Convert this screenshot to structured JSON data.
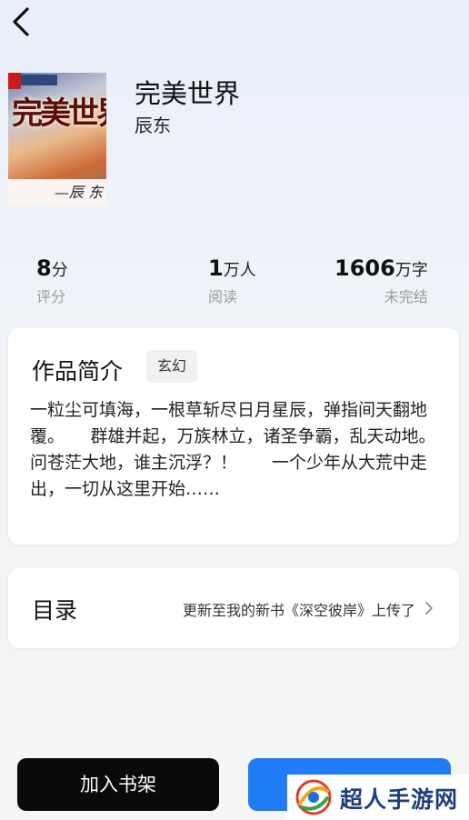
{
  "book": {
    "title": "完美世界",
    "author": "辰东",
    "cover_title": "完美世界",
    "cover_author": "—辰 东"
  },
  "stats": {
    "rating": {
      "value": "8",
      "unit": "分",
      "label": "评分"
    },
    "readers": {
      "value": "1",
      "unit": "万人",
      "label": "阅读"
    },
    "words": {
      "value": "1606",
      "unit": "万字",
      "label": "未完结"
    }
  },
  "intro": {
    "heading": "作品简介",
    "genre": "玄幻",
    "text": "一粒尘可填海，一根草斩尽日月星辰，弹指间天翻地覆。　　群雄并起，万族林立，诸圣争霸，乱天动地。问苍茫大地，谁主沉浮？！　　一个少年从大荒中走出，一切从这里开始……"
  },
  "toc": {
    "heading": "目录",
    "latest": "更新至我的新书《深空彼岸》上传了"
  },
  "actions": {
    "add_to_shelf": "加入书架",
    "read": ""
  },
  "watermark": {
    "text": "超人手游网"
  },
  "icons": {
    "back": "chevron-left-icon",
    "toc_arrow": "chevron-right-icon"
  },
  "colors": {
    "primary_button": "#1f7cf2",
    "shelf_button": "#0a0a0a"
  }
}
